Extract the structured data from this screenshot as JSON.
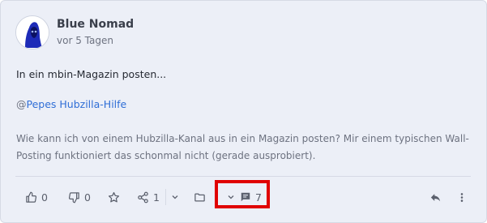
{
  "post": {
    "author": "Blue Nomad",
    "time": "vor 5 Tagen",
    "title": "In ein mbin-Magazin posten...",
    "mention_prefix": "@",
    "mention": "Pepes Hubzilla-Hilfe",
    "body": "Wie kann ich von einem Hubzilla-Kanal aus in ein Magazin posten? Mir einem typischen Wall-Posting funktioniert das schonmal nicht (gerade ausprobiert)."
  },
  "actions": {
    "likes": "0",
    "dislikes": "0",
    "boosts": "1",
    "comments": "7"
  },
  "icons": {
    "like": "thumb-up-icon",
    "dislike": "thumb-down-icon",
    "star": "star-icon",
    "share": "share-icon",
    "folder": "folder-icon",
    "comment": "comment-icon",
    "reply": "reply-icon",
    "more": "more-vertical-icon"
  },
  "colors": {
    "card_bg": "#eceff7",
    "link": "#2f6ed6",
    "highlight": "#e00000"
  }
}
